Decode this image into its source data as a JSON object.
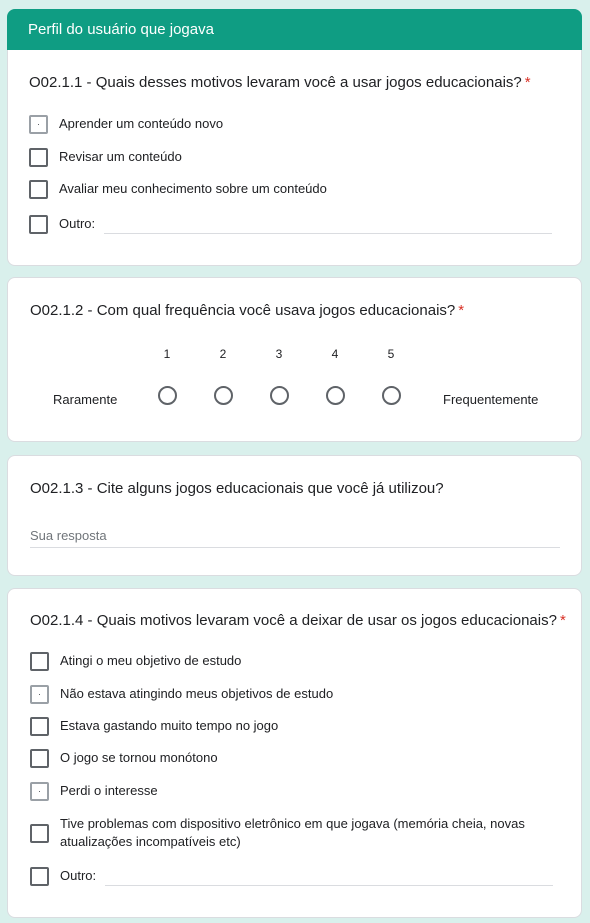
{
  "section": {
    "title": "Perfil do usuário que jogava"
  },
  "accent_color": "#0f9d83",
  "required_marker": "*",
  "q1": {
    "title": "O02.1.1 - Quais desses motivos levaram você a usar jogos educacionais?",
    "options": [
      "Aprender um conteúdo novo",
      "Revisar um conteúdo",
      "Avaliar meu conhecimento sobre um conteúdo",
      "Outro:"
    ]
  },
  "q2": {
    "title": "O02.1.2 - Com qual frequência você usava jogos educacionais?",
    "scale": [
      "1",
      "2",
      "3",
      "4",
      "5"
    ],
    "low_label": "Raramente",
    "high_label": "Frequentemente"
  },
  "q3": {
    "title": "O02.1.3 - Cite alguns jogos educacionais que você já utilizou?",
    "placeholder": "Sua resposta"
  },
  "q4": {
    "title": "O02.1.4 - Quais motivos levaram você a deixar de usar os jogos educacionais?",
    "options": [
      "Atingi o meu objetivo de estudo",
      "Não estava atingindo meus objetivos de estudo",
      "Estava gastando muito tempo no jogo",
      "O jogo se tornou monótono",
      "Perdi o interesse",
      "Tive problemas com dispositivo eletrônico em que jogava (memória cheia, novas atualizações incompatíveis etc)",
      "Outro:"
    ]
  }
}
